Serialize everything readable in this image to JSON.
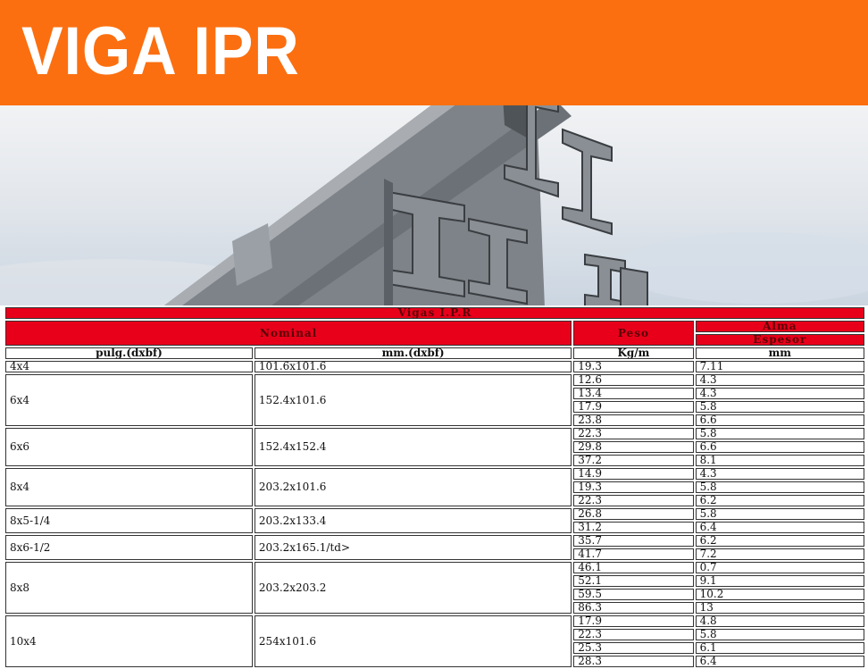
{
  "banner": {
    "title": "VIGA IPR",
    "color": "#fb6f10"
  },
  "table": {
    "caption": "Vigas I.P.R",
    "group_headers": {
      "nominal": "Nominal",
      "peso": "Peso",
      "alma": "Alma",
      "espesor": "Espesor"
    },
    "col_headers": {
      "pulg": "pulg.(dxbf)",
      "mm": "mm.(dxbf)",
      "kg": "Kg/m",
      "espesor_mm": "mm"
    },
    "header_color": "#e8001a",
    "groups": [
      {
        "pulg": "4x4",
        "mm": "101.6x101.6",
        "rows": [
          {
            "kg": "19.3",
            "esp": "7.11"
          }
        ]
      },
      {
        "pulg": "6x4",
        "mm": "152.4x101.6",
        "rows": [
          {
            "kg": "12.6",
            "esp": "4.3"
          },
          {
            "kg": "13.4",
            "esp": "4.3"
          },
          {
            "kg": "17.9",
            "esp": "5.8"
          },
          {
            "kg": "23.8",
            "esp": "6.6"
          }
        ]
      },
      {
        "pulg": "6x6",
        "mm": "152.4x152.4",
        "rows": [
          {
            "kg": "22.3",
            "esp": "5.8"
          },
          {
            "kg": "29.8",
            "esp": "6.6"
          },
          {
            "kg": "37.2",
            "esp": "8.1"
          }
        ]
      },
      {
        "pulg": "8x4",
        "mm": "203.2x101.6",
        "rows": [
          {
            "kg": "14.9",
            "esp": "4.3"
          },
          {
            "kg": "19.3",
            "esp": "5.8"
          },
          {
            "kg": "22.3",
            "esp": "6.2"
          }
        ]
      },
      {
        "pulg": "8x5-1/4",
        "mm": "203.2x133.4",
        "rows": [
          {
            "kg": "26.8",
            "esp": "5.8"
          },
          {
            "kg": "31.2",
            "esp": "6.4"
          }
        ]
      },
      {
        "pulg": "8x6-1/2",
        "mm": "203.2x165.1/td>",
        "rows": [
          {
            "kg": "35.7",
            "esp": "6.2"
          },
          {
            "kg": "41.7",
            "esp": "7.2"
          }
        ]
      },
      {
        "pulg": "8x8",
        "mm": "203.2x203.2",
        "rows": [
          {
            "kg": "46.1",
            "esp": "0.7"
          },
          {
            "kg": "52.1",
            "esp": "9.1"
          },
          {
            "kg": "59.5",
            "esp": "10.2"
          },
          {
            "kg": "86.3",
            "esp": "13"
          }
        ]
      },
      {
        "pulg": "10x4",
        "mm": "254x101.6",
        "rows": [
          {
            "kg": "17.9",
            "esp": "4.8"
          },
          {
            "kg": "22.3",
            "esp": "5.8"
          },
          {
            "kg": "25.3",
            "esp": "6.1"
          },
          {
            "kg": "28.3",
            "esp": "6.4"
          }
        ]
      }
    ]
  }
}
